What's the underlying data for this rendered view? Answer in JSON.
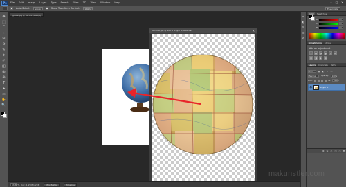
{
  "app": {
    "logo_text": "Ps",
    "menu": [
      "File",
      "Edit",
      "Image",
      "Layer",
      "Type",
      "Select",
      "Filter",
      "3D",
      "View",
      "Window",
      "Help"
    ],
    "window_controls": {
      "minimize": "–",
      "restore": "□",
      "close": "✕"
    }
  },
  "options_bar": {
    "auto_select_label": "Auto-Select:",
    "auto_select_value": "Group",
    "show_transform_label": "Show Transform Controls",
    "align_button": "Align",
    "workspace": "Essentials"
  },
  "document_tab": {
    "back_title": "globe.jpg @ 66.7% (RGB/8)"
  },
  "document_window": {
    "title": "texture.jpg @ 100% (Layer 0, RGB/8#)",
    "close": "✕"
  },
  "status_bar": {
    "zoom": "66.67%",
    "doc_info": "Doc: 1.29M/1.29M",
    "tabs": [
      "Mini Bridge",
      "Timeline"
    ]
  },
  "tools": [
    "✥",
    "⬚",
    "⌒",
    "⌁",
    "✂",
    "⊘",
    "✎",
    "⎈",
    "✐",
    "◧",
    "◍",
    "⊕",
    "T",
    "➤",
    "▭",
    "✋",
    "🔍"
  ],
  "panel_strip": [
    "▸",
    "◐",
    "✎",
    "☰",
    "⚙"
  ],
  "color_panel": {
    "tabs": [
      "Color",
      "Swatches"
    ],
    "sliders": [
      {
        "letter": "R",
        "value": "0"
      },
      {
        "letter": "G",
        "value": "0"
      },
      {
        "letter": "B",
        "value": "0"
      }
    ]
  },
  "adjustments_panel": {
    "tabs": [
      "Adjustments",
      "Styles"
    ],
    "title": "Add an adjustment",
    "icons": [
      "☀",
      "▦",
      "◑",
      "◒",
      "▽",
      "⚖",
      "▣",
      "◪",
      "◈",
      "▤"
    ]
  },
  "layers_panel": {
    "tabs": [
      "Layers",
      "Channels",
      "Paths"
    ],
    "filter_kind": "Kind",
    "blend_mode": "Normal",
    "opacity_label": "Opacity:",
    "opacity_value": "100%",
    "lock_label": "Lock:",
    "fill_label": "Fill:",
    "fill_value": "100%",
    "layers": [
      {
        "name": "Layer 0",
        "visible": true
      }
    ],
    "footer_icons": [
      "⛓",
      "fx",
      "◐",
      "◫",
      "▢",
      "🗑"
    ]
  },
  "watermark": "makunstler.com",
  "colors": {
    "arrow": "#e8242a",
    "selection_blue": "#5b8ac2",
    "panel_bg": "#535353",
    "workspace_bg": "#282828"
  }
}
